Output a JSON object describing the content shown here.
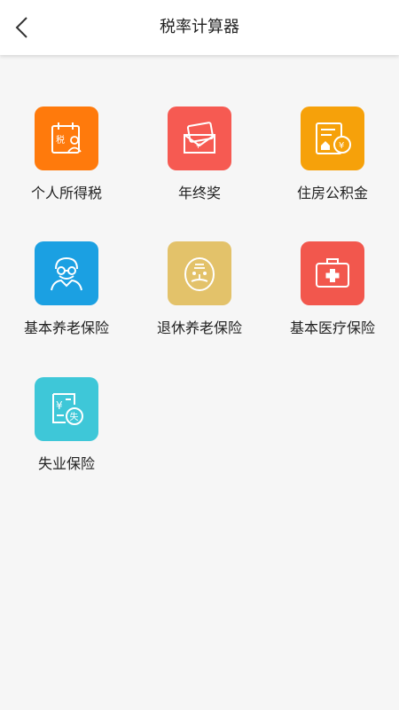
{
  "header": {
    "title": "税率计算器",
    "back_icon": "chevron-left-icon"
  },
  "items": [
    {
      "label": "个人所得税",
      "color": "#ff7a0c",
      "icon": "tax-person-icon"
    },
    {
      "label": "年终奖",
      "color": "#f65a52",
      "icon": "bonus-envelope-icon"
    },
    {
      "label": "住房公积金",
      "color": "#f6a10a",
      "icon": "housing-fund-icon"
    },
    {
      "label": "基本养老保险",
      "color": "#1ba0e2",
      "icon": "elder-person-icon"
    },
    {
      "label": "退休养老保险",
      "color": "#e3c26a",
      "icon": "retiree-face-icon"
    },
    {
      "label": "基本医疗保险",
      "color": "#f2574d",
      "icon": "medical-kit-icon"
    },
    {
      "label": "失业保险",
      "color": "#3ec7d8",
      "icon": "unemployment-icon"
    }
  ]
}
